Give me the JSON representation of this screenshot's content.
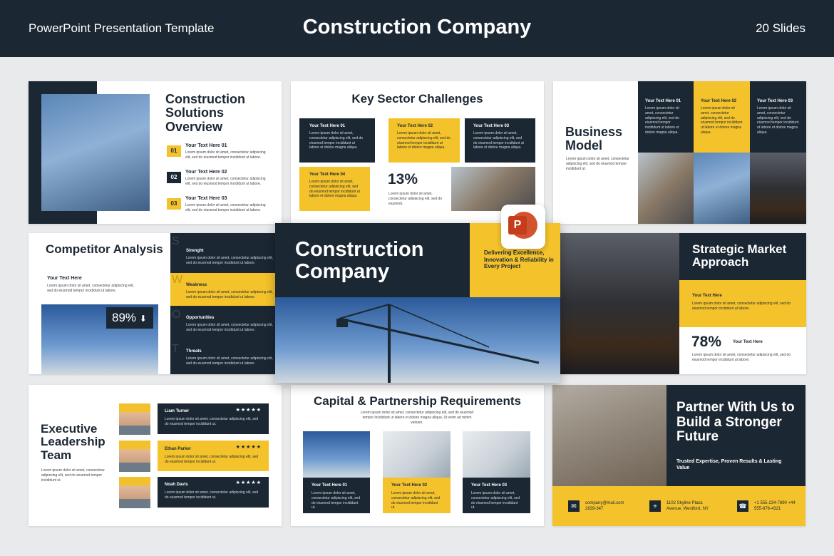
{
  "header": {
    "left": "PowerPoint Presentation Template",
    "title": "Construction Company",
    "right": "20 Slides"
  },
  "lorem_short": "Lorem ipsum dolor sit amet, consectetur adipiscing elit, sed do eiusmod tempor incididunt ut labore.",
  "lorem_two": "Lorem ipsum dolor sit amet, consectetur adipiscing elit, sed do eiusmod tempor incididunt ut labore.",
  "lorem_card": "Lorem ipsum dolor sit amet, consectetur adipiscing elit, sed do eiusmod tempor incididunt ut labore et dolore magna aliqua.",
  "lorem_tiny": "Lorem ipsum dolor sit amet, consectetur adipiscing elit, sed do eiusmod.",
  "lorem_tempor": "Lorem ipsum dolor sit amet, consectetur adipiscing elit, sed do eiusmod tempor incididunt ut.",
  "lorem_cap": "Lorem ipsum dolor sit amet, consectetur adipiscing elit, sed do eiusmod tempor incididunt ut labore et dolore magna aliqua. Ut enim ad minim veniam.",
  "slide1": {
    "title": "Construction Solutions Overview",
    "items": [
      {
        "num": "01",
        "label": "Your Text Here 01"
      },
      {
        "num": "02",
        "label": "Your Text Here 02"
      },
      {
        "num": "03",
        "label": "Your Text Here 03"
      }
    ]
  },
  "slide2": {
    "title": "Key Sector Challenges",
    "cards": [
      "Your Text Here 01",
      "Your Text Here 02",
      "Your Text Here 03",
      "Your Text Here 04"
    ],
    "stat": "13%"
  },
  "slide3": {
    "title": "Business Model",
    "cols": [
      "Your Text Here 01",
      "Your Text Here 02",
      "Your Text Here 03"
    ]
  },
  "slide4": {
    "title": "Competitor Analysis",
    "sub": "Your Text Here",
    "stat": "89%",
    "swot": [
      {
        "letter": "S",
        "label": "Strenght"
      },
      {
        "letter": "W",
        "label": "Weakness"
      },
      {
        "letter": "O",
        "label": "Opportunities"
      },
      {
        "letter": "T",
        "label": "Threats"
      }
    ]
  },
  "slide5": {
    "title": "Construction Company",
    "tagline": "Delivering Excellence, Innovation & Reliability in Every Project",
    "app_icon": "powerpoint-icon",
    "app_letter": "P"
  },
  "slide6": {
    "title": "Strategic Market Approach",
    "label": "Your Text Here",
    "stat": "78%",
    "stat_label": "Your Text Here"
  },
  "slide7": {
    "title": "Executive Leadership Team",
    "members": [
      {
        "name": "Liam Turner",
        "stars": "★★★★★"
      },
      {
        "name": "Ethan Parker",
        "stars": "★★★★★"
      },
      {
        "name": "Noah Davis",
        "stars": "★★★★★"
      }
    ]
  },
  "slide8": {
    "title": "Capital & Partnership Requirements",
    "cards": [
      "Your Text Here 01",
      "Your Text Here 02",
      "Your Text Here 03"
    ]
  },
  "slide9": {
    "title": "Partner With Us to Build a Stronger Future",
    "sub": "Trusted Expertise, Proven Results & Lasting Value",
    "contacts": [
      {
        "icon": "mail-icon",
        "glyph": "✉",
        "text": "company@mail.com 2839-347"
      },
      {
        "icon": "location-icon",
        "glyph": "⌖",
        "text": "1102 Skyline Plaza Avenue, Westford, NY"
      },
      {
        "icon": "phone-icon",
        "glyph": "☎",
        "text": "+1 555-234-7890 +44 555-876-4321"
      }
    ]
  },
  "colors": {
    "navy": "#1b2733",
    "yellow": "#f4c22b",
    "background": "#e9eaeb"
  }
}
